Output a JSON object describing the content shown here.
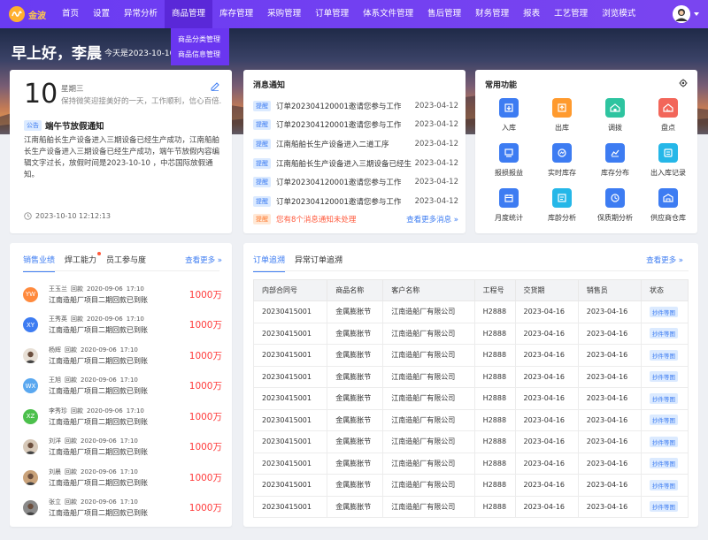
{
  "brand": {
    "name": "金波"
  },
  "nav": {
    "items": [
      "首页",
      "设置",
      "异常分析",
      "商品管理",
      "库存管理",
      "采购管理",
      "订单管理",
      "体系文件管理",
      "售后管理",
      "财务管理",
      "报表",
      "工艺管理",
      "浏览模式"
    ],
    "active_index": 3,
    "submenu": [
      "商品分类管理",
      "商品信息管理"
    ]
  },
  "hero": {
    "greeting": "早上好，李晨",
    "date_text": "今天是2023-10-10"
  },
  "today": {
    "day": "10",
    "weekday": "星期三",
    "motto": "保持微笑迎接美好的一天，工作顺利，信心百倍.",
    "notice_tag": "公告",
    "notice_title": "端午节放假通知",
    "notice_body": "江南船舶长生产设备进入三期设备已经生产成功，江南船舶长生产设备进入三期设备已经生产成功，端午节放假内容编辑文字过长，放假时间是2023-10-10 ，中芯国际放假通知。",
    "timestamp": "2023-10-10 12:12:13"
  },
  "messages": {
    "title": "消息通知",
    "tag": "提醒",
    "items": [
      {
        "text": "订单202304120001邀请您参与工作",
        "date": "2023-04-12"
      },
      {
        "text": "订单202304120001邀请您参与工作",
        "date": "2023-04-12"
      },
      {
        "text": "江南船舶长生产设备进入二道工序",
        "date": "2023-04-12"
      },
      {
        "text": "江南船舶长生产设备进入三期设备已经生产成功",
        "date": "2023-04-12"
      },
      {
        "text": "订单202304120001邀请您参与工作",
        "date": "2023-04-12"
      },
      {
        "text": "订单202304120001邀请您参与工作",
        "date": "2023-04-12"
      }
    ],
    "footer_tag": "提醒",
    "footer_warn": "您有8个消息通知未处理",
    "more": "查看更多消息 »"
  },
  "functions": {
    "title": "常用功能",
    "items": [
      {
        "label": "入库",
        "icon": "inbound-icon",
        "color": "#3d7cf2"
      },
      {
        "label": "出库",
        "icon": "outbound-icon",
        "color": "#ff9a2e"
      },
      {
        "label": "调拨",
        "icon": "transfer-icon",
        "color": "#2ec4a0"
      },
      {
        "label": "盘点",
        "icon": "inventory-check-icon",
        "color": "#f2665a"
      },
      {
        "label": "报损报益",
        "icon": "loss-report-icon",
        "color": "#3d7cf2"
      },
      {
        "label": "实时库存",
        "icon": "realtime-stock-icon",
        "color": "#3d7cf2"
      },
      {
        "label": "库存分布",
        "icon": "stock-distribution-icon",
        "color": "#3d7cf2"
      },
      {
        "label": "出入库记录",
        "icon": "io-record-icon",
        "color": "#25b7e8"
      },
      {
        "label": "月度统计",
        "icon": "monthly-stats-icon",
        "color": "#3d7cf2"
      },
      {
        "label": "库龄分析",
        "icon": "stock-age-icon",
        "color": "#25b7e8"
      },
      {
        "label": "保质期分析",
        "icon": "shelf-life-icon",
        "color": "#3d7cf2"
      },
      {
        "label": "供应商仓库",
        "icon": "supplier-warehouse-icon",
        "color": "#3d7cf2"
      }
    ]
  },
  "sales": {
    "tabs": [
      "销售业绩",
      "焊工能力",
      "员工参与度"
    ],
    "active_tab": 0,
    "more": "查看更多 »",
    "action": "回款",
    "desc": "江南造船厂项目二期回款已到账",
    "items": [
      {
        "name": "王玉兰",
        "date": "2020-09-06",
        "time": "17:10",
        "amount": "1000万",
        "initials": "YW",
        "color": "#ff8a3d"
      },
      {
        "name": "王秀英",
        "date": "2020-09-06",
        "time": "17:10",
        "amount": "1000万",
        "initials": "XY",
        "color": "#3d7cf2"
      },
      {
        "name": "杨辉",
        "date": "2020-09-06",
        "time": "17:10",
        "amount": "1000万",
        "initials": "",
        "color": "#e8e0d6"
      },
      {
        "name": "王旭",
        "date": "2020-09-06",
        "time": "17:10",
        "amount": "1000万",
        "initials": "WX",
        "color": "#5aa8f0"
      },
      {
        "name": "李秀珍",
        "date": "2020-09-06",
        "time": "17:10",
        "amount": "1000万",
        "initials": "XZ",
        "color": "#4cc04c"
      },
      {
        "name": "刘洋",
        "date": "2020-09-06",
        "time": "17:10",
        "amount": "1000万",
        "initials": "",
        "color": "#d6c8b8"
      },
      {
        "name": "刘晨",
        "date": "2020-09-06",
        "time": "17:10",
        "amount": "1000万",
        "initials": "",
        "color": "#c9a27a"
      },
      {
        "name": "张立",
        "date": "2020-09-06",
        "time": "17:10",
        "amount": "1000万",
        "initials": "",
        "color": "#8a8a8a"
      }
    ]
  },
  "orders": {
    "tabs": [
      "订单追溯",
      "异常订单追溯"
    ],
    "active_tab": 0,
    "more": "查看更多 »",
    "columns": [
      "内部合同号",
      "商品名称",
      "客户名称",
      "工程号",
      "交货期",
      "销售员",
      "状态"
    ],
    "rows": [
      [
        "20230415001",
        "金属膨胀节",
        "江南造船厂有限公司",
        "H2888",
        "2023-04-16",
        "2023-04-16",
        "抄件等图"
      ],
      [
        "20230415001",
        "金属膨胀节",
        "江南造船厂有限公司",
        "H2888",
        "2023-04-16",
        "2023-04-16",
        "抄件等图"
      ],
      [
        "20230415001",
        "金属膨胀节",
        "江南造船厂有限公司",
        "H2888",
        "2023-04-16",
        "2023-04-16",
        "抄件等图"
      ],
      [
        "20230415001",
        "金属膨胀节",
        "江南造船厂有限公司",
        "H2888",
        "2023-04-16",
        "2023-04-16",
        "抄件等图"
      ],
      [
        "20230415001",
        "金属膨胀节",
        "江南造船厂有限公司",
        "H2888",
        "2023-04-16",
        "2023-04-16",
        "抄件等图"
      ],
      [
        "20230415001",
        "金属膨胀节",
        "江南造船厂有限公司",
        "H2888",
        "2023-04-16",
        "2023-04-16",
        "抄件等图"
      ],
      [
        "20230415001",
        "金属膨胀节",
        "江南造船厂有限公司",
        "H2888",
        "2023-04-16",
        "2023-04-16",
        "抄件等图"
      ],
      [
        "20230415001",
        "金属膨胀节",
        "江南造船厂有限公司",
        "H2888",
        "2023-04-16",
        "2023-04-16",
        "抄件等图"
      ],
      [
        "20230415001",
        "金属膨胀节",
        "江南造船厂有限公司",
        "H2888",
        "2023-04-16",
        "2023-04-16",
        "抄件等图"
      ],
      [
        "20230415001",
        "金属膨胀节",
        "江南造船厂有限公司",
        "H2888",
        "2023-04-16",
        "2023-04-16",
        "抄件等图"
      ]
    ]
  }
}
